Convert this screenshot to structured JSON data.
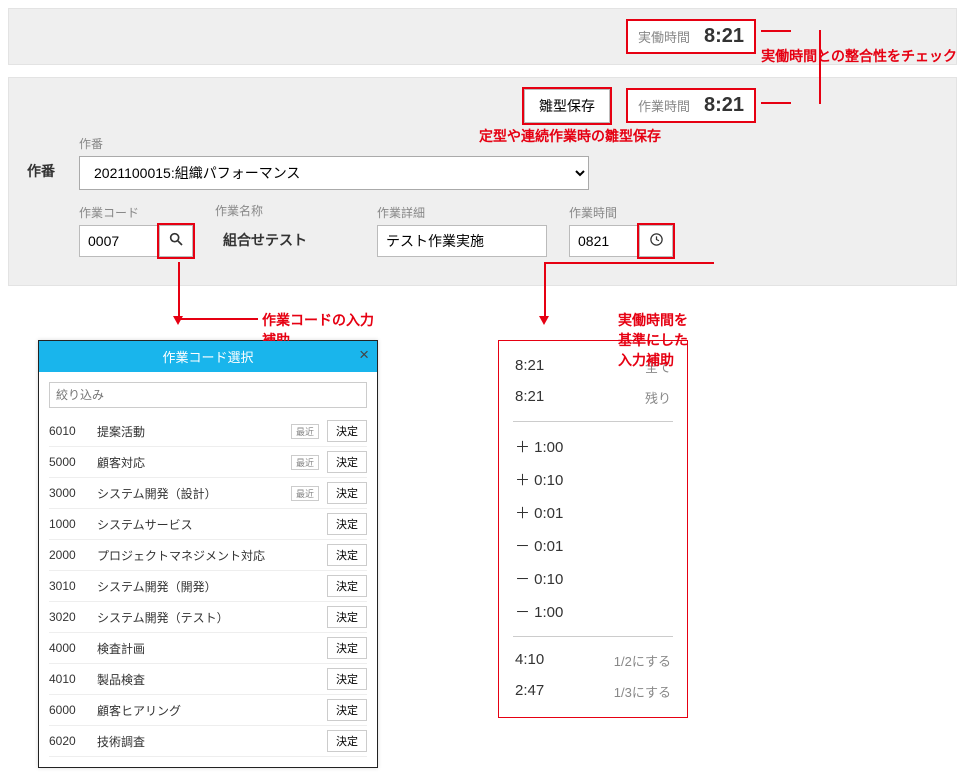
{
  "header": {
    "actual_label": "実働時間",
    "actual_value": "8:21"
  },
  "annotations": {
    "consistency": "実働時間との整合性をチェック",
    "template_save": "定型や連続作業時の雛型保存",
    "code_assist": "作業コードの入力補助",
    "time_assist": "実働時間を基準にした入力補助"
  },
  "task_block": {
    "save_template_btn": "雛型保存",
    "work_time_label": "作業時間",
    "work_time_value": "8:21",
    "section_title": "作番",
    "project_label": "作番",
    "project_select": "2021100015:組織パフォーマンス",
    "code_label": "作業コード",
    "code_value": "0007",
    "name_label": "作業名称",
    "name_value": "組合せテスト",
    "detail_label": "作業詳細",
    "detail_value": "テスト作業実施",
    "time_label": "作業時間",
    "time_value": "0821"
  },
  "code_popup": {
    "title": "作業コード選択",
    "filter_placeholder": "絞り込み",
    "recent_badge": "最近",
    "decide_btn": "決定",
    "rows": [
      {
        "code": "6010",
        "name": "提案活動",
        "recent": true
      },
      {
        "code": "5000",
        "name": "顧客対応",
        "recent": true
      },
      {
        "code": "3000",
        "name": "システム開発（設計）",
        "recent": true
      },
      {
        "code": "1000",
        "name": "システムサービス",
        "recent": false
      },
      {
        "code": "2000",
        "name": "プロジェクトマネジメント対応",
        "recent": false
      },
      {
        "code": "3010",
        "name": "システム開発（開発）",
        "recent": false
      },
      {
        "code": "3020",
        "name": "システム開発（テスト）",
        "recent": false
      },
      {
        "code": "4000",
        "name": "検査計画",
        "recent": false
      },
      {
        "code": "4010",
        "name": "製品検査",
        "recent": false
      },
      {
        "code": "6000",
        "name": "顧客ヒアリング",
        "recent": false
      },
      {
        "code": "6020",
        "name": "技術調査",
        "recent": false
      }
    ]
  },
  "time_popup": {
    "presets": [
      {
        "v": "8:21",
        "t": "全て"
      },
      {
        "v": "8:21",
        "t": "残り"
      }
    ],
    "increments": [
      {
        "v": "＋ 1:00"
      },
      {
        "v": "＋ 0:10"
      },
      {
        "v": "＋ 0:01"
      },
      {
        "v": "－ 0:01"
      },
      {
        "v": "－ 0:10"
      },
      {
        "v": "－ 1:00"
      }
    ],
    "fractions": [
      {
        "v": "4:10",
        "t": "1/2にする"
      },
      {
        "v": "2:47",
        "t": "1/3にする"
      }
    ]
  }
}
